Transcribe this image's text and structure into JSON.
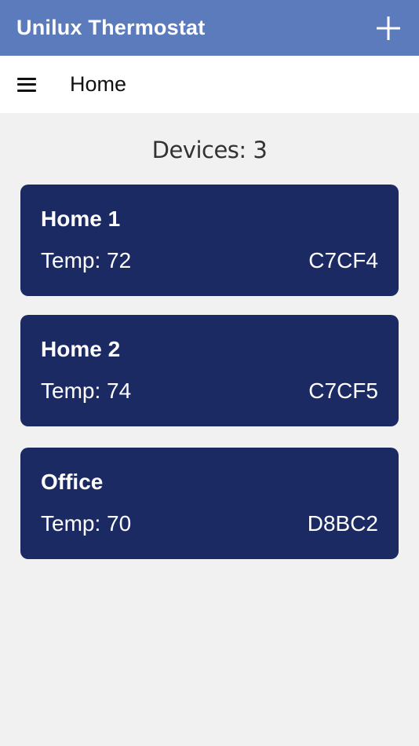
{
  "app_bar": {
    "title": "Unilux Thermostat",
    "add_icon": "plus-icon",
    "background": "#5b7bbd"
  },
  "nav_bar": {
    "menu_icon": "hamburger-menu-icon",
    "title": "Home"
  },
  "content": {
    "device_count_text": "Devices: 3",
    "devices": [
      {
        "name": "Home 1",
        "temp_text": "Temp: 72",
        "id": "C7CF4"
      },
      {
        "name": "Home 2",
        "temp_text": "Temp: 74",
        "id": "C7CF5"
      },
      {
        "name": "Office",
        "temp_text": "Temp: 70",
        "id": "D8BC2"
      }
    ],
    "card_color": "#1b2a63"
  }
}
